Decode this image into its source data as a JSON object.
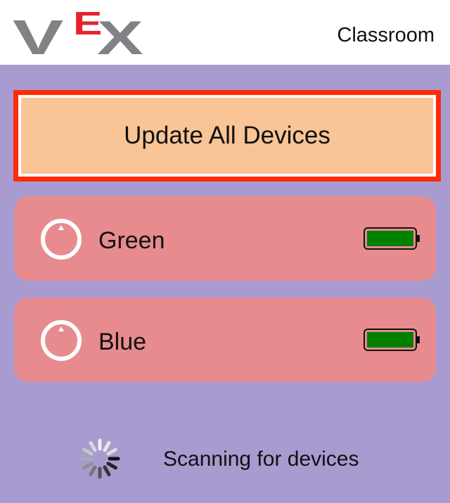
{
  "header": {
    "logo": {
      "letter_v": "V",
      "letter_e": "E",
      "letter_x": "X",
      "color_gray": "#808285",
      "color_red": "#e5232f"
    },
    "title": "Classroom"
  },
  "main": {
    "update_button_label": "Update All Devices",
    "devices": [
      {
        "name": "Green",
        "icon": "brain-icon",
        "battery_level": 1.0,
        "battery_icon": "battery-full-icon"
      },
      {
        "name": "Blue",
        "icon": "brain-icon",
        "battery_level": 1.0,
        "battery_icon": "battery-full-icon"
      }
    ],
    "status": {
      "icon": "spinner-icon",
      "text": "Scanning for devices"
    }
  },
  "colors": {
    "background": "#a89bd0",
    "header": "#ffffff",
    "button_fill": "#f9c496",
    "button_border": "#ff2a08",
    "card": "#e88b8f",
    "battery_fill": "#008000"
  }
}
